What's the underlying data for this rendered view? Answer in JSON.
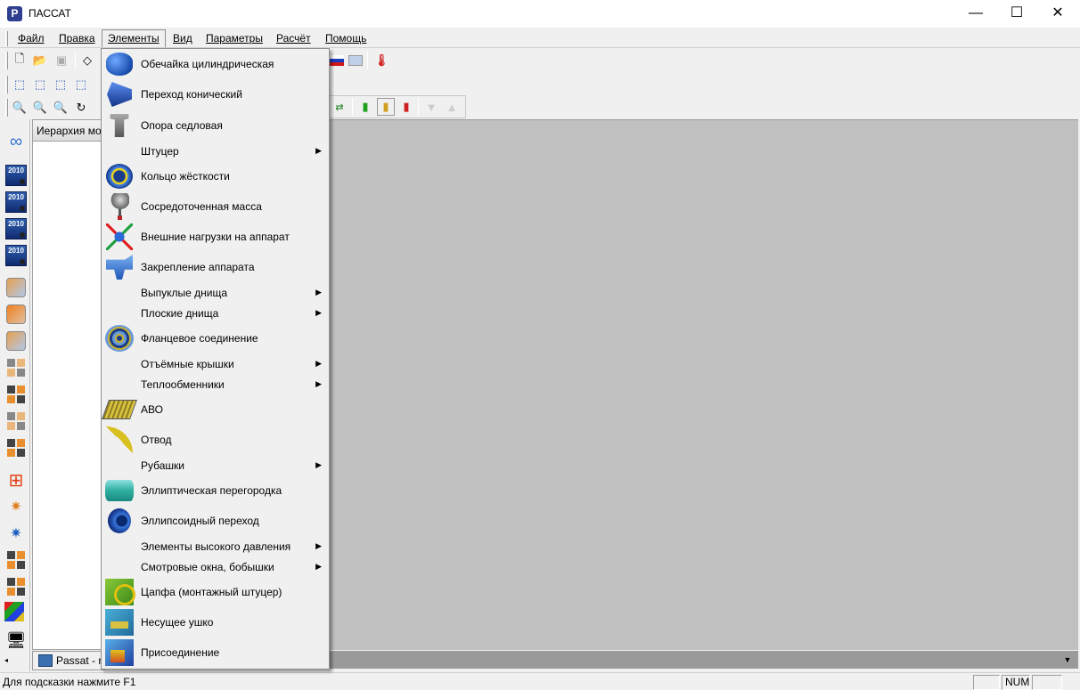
{
  "window": {
    "title": "ПАССАТ",
    "minimize_glyph": "—",
    "maximize_glyph": "☐",
    "close_glyph": "✕"
  },
  "menu": [
    "Файл",
    "Правка",
    "Элементы",
    "Вид",
    "Параметры",
    "Расчёт",
    "Помощь"
  ],
  "active_menu": "Элементы",
  "dropdown": [
    {
      "label": "Обечайка цилиндрическая",
      "icon": "cylinder-shell-icon",
      "submenu": false
    },
    {
      "label": "Переход конический",
      "icon": "conical-transition-icon",
      "submenu": false
    },
    {
      "label": "Опора седловая",
      "icon": "saddle-support-icon",
      "submenu": false
    },
    {
      "label": "Штуцер",
      "icon": "",
      "submenu": true
    },
    {
      "label": "Кольцо жёсткости",
      "icon": "stiffening-ring-icon",
      "submenu": false
    },
    {
      "label": "Сосредоточенная масса",
      "icon": "concentrated-mass-icon",
      "submenu": false
    },
    {
      "label": "Внешние нагрузки на аппарат",
      "icon": "external-loads-icon",
      "submenu": false
    },
    {
      "label": "Закрепление аппарата",
      "icon": "vessel-fixation-icon",
      "submenu": false
    },
    {
      "label": "Выпуклые днища",
      "icon": "",
      "submenu": true
    },
    {
      "label": "Плоские днища",
      "icon": "",
      "submenu": true
    },
    {
      "label": "Фланцевое соединение",
      "icon": "flange-joint-icon",
      "submenu": false
    },
    {
      "label": "Отъёмные крышки",
      "icon": "",
      "submenu": true
    },
    {
      "label": "Теплообменники",
      "icon": "",
      "submenu": true
    },
    {
      "label": "АВО",
      "icon": "air-cooler-icon",
      "submenu": false
    },
    {
      "label": "Отвод",
      "icon": "pipe-bend-icon",
      "submenu": false
    },
    {
      "label": "Рубашки",
      "icon": "",
      "submenu": true
    },
    {
      "label": "Эллиптическая перегородка",
      "icon": "elliptical-partition-icon",
      "submenu": false
    },
    {
      "label": "Эллипсоидный переход",
      "icon": "ellipsoidal-transition-icon",
      "submenu": false
    },
    {
      "label": "Элементы высокого давления",
      "icon": "",
      "submenu": true
    },
    {
      "label": "Смотровые окна, бобышки",
      "icon": "",
      "submenu": true
    },
    {
      "label": "Цапфа (монтажный штуцер)",
      "icon": "trunnion-icon",
      "submenu": false
    },
    {
      "label": "Несущее ушко",
      "icon": "lifting-lug-icon",
      "submenu": false
    },
    {
      "label": "Присоединение",
      "icon": "connection-icon",
      "submenu": false
    }
  ],
  "tree_panel": {
    "header": "Иерархия мод"
  },
  "bottom_tab": {
    "label": "Passat - r"
  },
  "status": {
    "hint": "Для подсказки нажмите F1",
    "num": "NUM"
  },
  "year_badge": "2010",
  "submenu_arrow": "▶",
  "colors": {
    "workspace": "#c0c0c0",
    "menu_bg": "#f0f0f0",
    "tab_strip": "#9a9a9a"
  }
}
